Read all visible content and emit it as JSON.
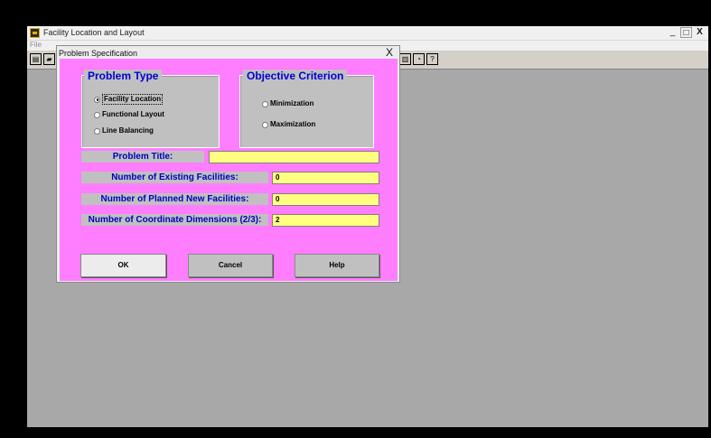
{
  "app": {
    "title": "Facility Location and Layout",
    "menu_file": "File"
  },
  "window_controls": {
    "minimize": "_",
    "maximize": "□",
    "close": "X"
  },
  "dialog": {
    "title": "Problem Specification",
    "close": "X",
    "problem_type": {
      "title": "Problem Type",
      "options": [
        "Facility Location",
        "Functional Layout",
        "Line Balancing"
      ],
      "selected": "Facility Location"
    },
    "objective": {
      "title": "Objective Criterion",
      "options": [
        "Minimization",
        "Maximization"
      ],
      "selected": ""
    },
    "fields": {
      "problem_title": {
        "label": "Problem Title:",
        "value": ""
      },
      "existing": {
        "label": "Number of Existing Facilities:",
        "value": "0"
      },
      "planned": {
        "label": "Number of Planned New Facilities:",
        "value": "0"
      },
      "dimensions": {
        "label": "Number of Coordinate Dimensions (2/3):",
        "value": "2"
      }
    },
    "buttons": {
      "ok": "OK",
      "cancel": "Cancel",
      "help": "Help"
    }
  },
  "colors": {
    "dialog_bg": "#ff7dff",
    "group_title": "#0000d8",
    "input_bg": "#ffff80",
    "workspace": "#a8a8a8"
  },
  "icons": [
    "app-icon",
    "new-file-icon",
    "open-file-icon",
    "clock-icon",
    "help-icon"
  ]
}
